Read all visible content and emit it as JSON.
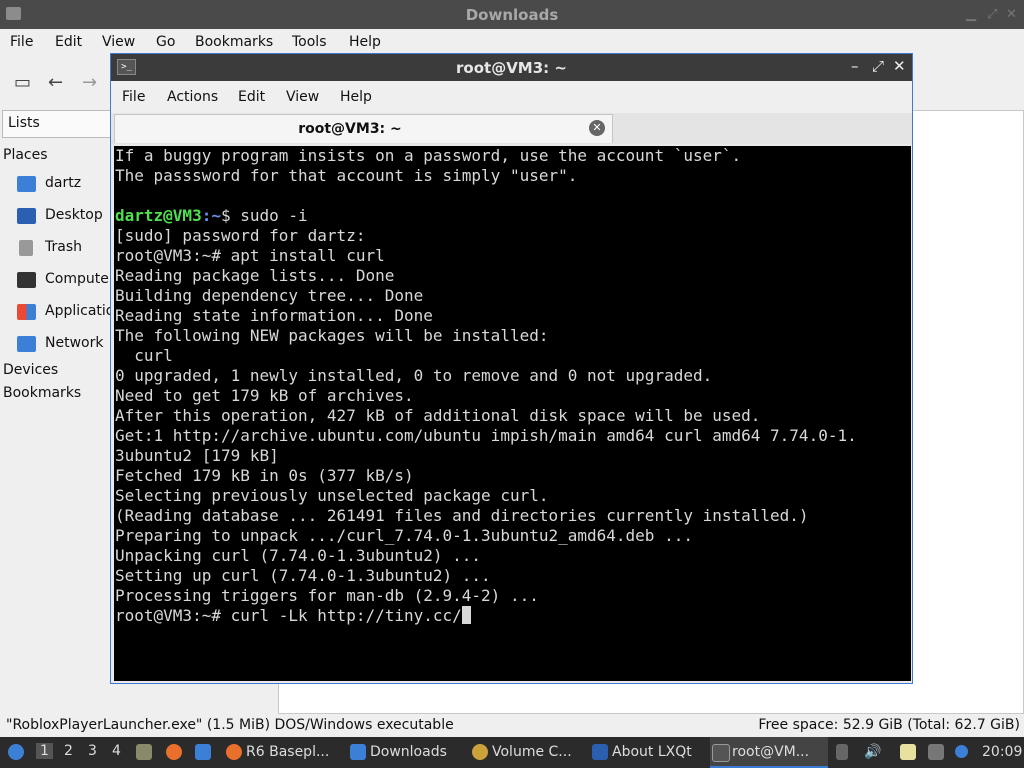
{
  "file_manager": {
    "title": "Downloads",
    "menu": [
      "File",
      "Edit",
      "View",
      "Go",
      "Bookmarks",
      "Tools",
      "Help"
    ],
    "side_pane_mode": "Lists",
    "places_header": "Places",
    "places": [
      {
        "label": "dartz",
        "icon": "home-folder-icon"
      },
      {
        "label": "Desktop",
        "icon": "desktop-icon"
      },
      {
        "label": "Trash",
        "icon": "trash-icon"
      },
      {
        "label": "Computer",
        "icon": "computer-icon"
      },
      {
        "label": "Applicatio",
        "icon": "applications-icon"
      },
      {
        "label": "Network",
        "icon": "network-icon"
      }
    ],
    "devices_header": "Devices",
    "bookmarks_header": "Bookmarks",
    "status_left": "\"RobloxPlayerLauncher.exe\" (1.5 MiB) DOS/Windows executable",
    "status_right": "Free space: 52.9 GiB (Total: 62.7 GiB)"
  },
  "terminal": {
    "title": "root@VM3: ~",
    "menu": [
      "File",
      "Actions",
      "Edit",
      "View",
      "Help"
    ],
    "tab_label": "root@VM3: ~",
    "lines": [
      "If a buggy program insists on a password, use the account `user`.",
      "The passsword for that account is simply \"user\".",
      "",
      "[sudo] password for dartz:",
      "root@VM3:~# apt install curl",
      "Reading package lists... Done",
      "Building dependency tree... Done",
      "Reading state information... Done",
      "The following NEW packages will be installed:",
      "  curl",
      "0 upgraded, 1 newly installed, 0 to remove and 0 not upgraded.",
      "Need to get 179 kB of archives.",
      "After this operation, 427 kB of additional disk space will be used.",
      "Get:1 http://archive.ubuntu.com/ubuntu impish/main amd64 curl amd64 7.74.0-1.",
      "3ubuntu2 [179 kB]",
      "Fetched 179 kB in 0s (377 kB/s)",
      "Selecting previously unselected package curl.",
      "(Reading database ... 261491 files and directories currently installed.)",
      "Preparing to unpack .../curl_7.74.0-1.3ubuntu2_amd64.deb ...",
      "Unpacking curl (7.74.0-1.3ubuntu2) ...",
      "Setting up curl (7.74.0-1.3ubuntu2) ...",
      "Processing triggers for man-db (2.9.4-2) ...",
      "root@VM3:~# curl -Lk http://tiny.cc/"
    ],
    "prompt_user": "dartz@VM3",
    "prompt_path": ":~",
    "prompt_cmd": "$ sudo -i"
  },
  "taskbar": {
    "workspaces": [
      "1",
      "2",
      "3",
      "4"
    ],
    "tasks": [
      {
        "label": "R6 Basepl...",
        "icon": "firefox-icon"
      },
      {
        "label": "Downloads",
        "icon": "folder-icon"
      },
      {
        "label": "Volume C...",
        "icon": "volume-control-icon"
      },
      {
        "label": "About LXQt",
        "icon": "lxqt-icon"
      },
      {
        "label": "root@VM...",
        "icon": "terminal-icon"
      }
    ],
    "clock": "20:09"
  },
  "colors": {
    "accent": "#3a7bd5",
    "prompt_green": "#4ee04e",
    "prompt_blue": "#6a8cf0"
  }
}
